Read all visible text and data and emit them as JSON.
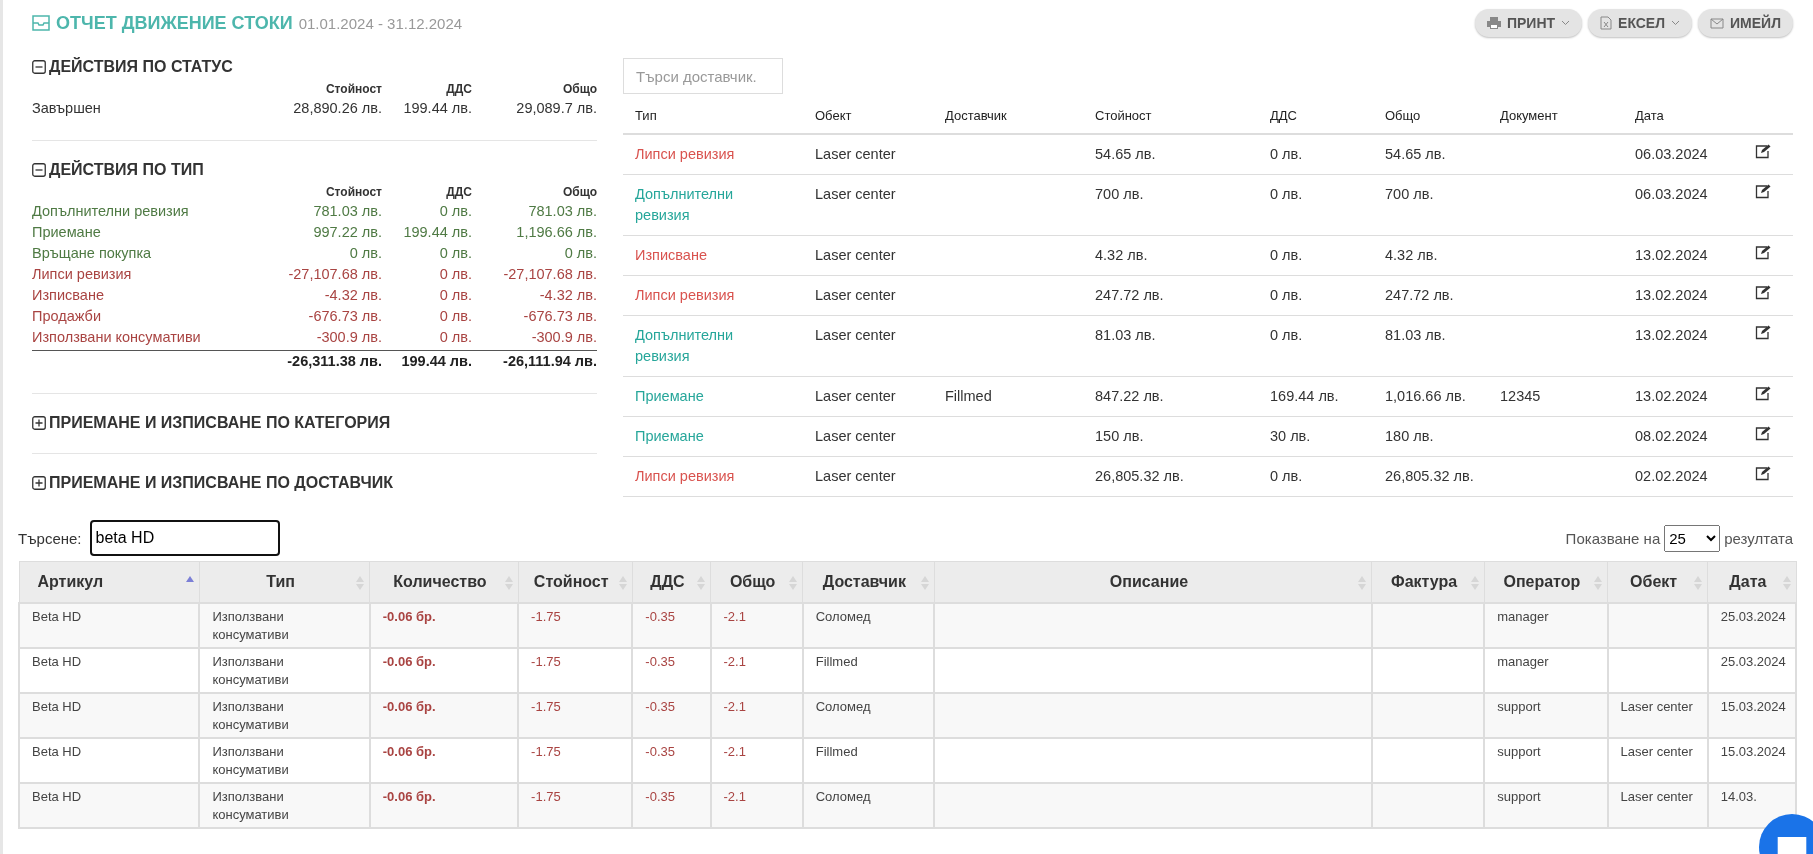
{
  "header": {
    "title": "ОТЧЕТ ДВИЖЕНИЕ СТОКИ",
    "period": "01.01.2024 - 31.12.2024"
  },
  "actions": [
    {
      "label": "ПРИНТ",
      "kind": "print",
      "dropdown": true
    },
    {
      "label": "ЕКСЕЛ",
      "kind": "excel",
      "dropdown": true
    },
    {
      "label": "ИМЕЙЛ",
      "kind": "email",
      "dropdown": false
    }
  ],
  "sections": [
    {
      "title": "ДЕЙСТВИЯ ПО СТАТУС",
      "expanded": true,
      "columns": [
        "Стойност",
        "ДДС",
        "Общо"
      ],
      "rows": [
        {
          "label": "Завършен",
          "kind": "neutral",
          "cells": [
            "28,890.26 лв.",
            "199.44 лв.",
            "29,089.7 лв."
          ]
        }
      ]
    },
    {
      "title": "ДЕЙСТВИЯ ПО ТИП",
      "expanded": true,
      "columns": [
        "Стойност",
        "ДДС",
        "Общо"
      ],
      "rows": [
        {
          "label": "Допълнителни ревизия",
          "kind": "positive",
          "cells": [
            "781.03 лв.",
            "0 лв.",
            "781.03 лв."
          ]
        },
        {
          "label": "Приемане",
          "kind": "positive",
          "cells": [
            "997.22 лв.",
            "199.44 лв.",
            "1,196.66 лв."
          ]
        },
        {
          "label": "Връщане покупка",
          "kind": "positive",
          "cells": [
            "0 лв.",
            "0 лв.",
            "0 лв."
          ]
        },
        {
          "label": "Липси ревизия",
          "kind": "negative",
          "cells": [
            "-27,107.68 лв.",
            "0 лв.",
            "-27,107.68 лв."
          ]
        },
        {
          "label": "Изписване",
          "kind": "negative",
          "cells": [
            "-4.32 лв.",
            "0 лв.",
            "-4.32 лв."
          ]
        },
        {
          "label": "Продажби",
          "kind": "negative",
          "cells": [
            "-676.73 лв.",
            "0 лв.",
            "-676.73 лв."
          ]
        },
        {
          "label": "Използвани консумативи",
          "kind": "negative",
          "cells": [
            "-300.9 лв.",
            "0 лв.",
            "-300.9 лв."
          ]
        }
      ],
      "totals": [
        "-26,311.38 лв.",
        "199.44 лв.",
        "-26,111.94 лв."
      ]
    },
    {
      "title": "ПРИЕМАНЕ И ИЗПИСВАНЕ ПО КАТЕГОРИЯ",
      "expanded": false
    },
    {
      "title": "ПРИЕМАНЕ И ИЗПИСВАНЕ ПО ДОСТАВЧИК",
      "expanded": false
    }
  ],
  "supplier_search": {
    "placeholder": "Търси доставчик."
  },
  "documents": {
    "columns": [
      "Тип",
      "Обект",
      "Доставчик",
      "Стойност",
      "ДДС",
      "Общо",
      "Документ",
      "Дата"
    ],
    "rows": [
      {
        "kind": "negative",
        "cells": [
          "Липси ревизия",
          "Laser center",
          "",
          "54.65 лв.",
          "0 лв.",
          "54.65 лв.",
          "",
          "06.03.2024"
        ]
      },
      {
        "kind": "positive",
        "cells": [
          "Допълнителни ревизия",
          "Laser center",
          "",
          "700 лв.",
          "0 лв.",
          "700 лв.",
          "",
          "06.03.2024"
        ]
      },
      {
        "kind": "negative",
        "cells": [
          "Изписване",
          "Laser center",
          "",
          "4.32 лв.",
          "0 лв.",
          "4.32 лв.",
          "",
          "13.02.2024"
        ]
      },
      {
        "kind": "negative",
        "cells": [
          "Липси ревизия",
          "Laser center",
          "",
          "247.72 лв.",
          "0 лв.",
          "247.72 лв.",
          "",
          "13.02.2024"
        ]
      },
      {
        "kind": "positive",
        "cells": [
          "Допълнителни ревизия",
          "Laser center",
          "",
          "81.03 лв.",
          "0 лв.",
          "81.03 лв.",
          "",
          "13.02.2024"
        ]
      },
      {
        "kind": "positive",
        "cells": [
          "Приемане",
          "Laser center",
          "Fillmed",
          "847.22 лв.",
          "169.44 лв.",
          "1,016.66 лв.",
          "12345",
          "13.02.2024"
        ]
      },
      {
        "kind": "positive",
        "cells": [
          "Приемане",
          "Laser center",
          "",
          "150 лв.",
          "30 лв.",
          "180 лв.",
          "",
          "08.02.2024"
        ]
      },
      {
        "kind": "negative",
        "cells": [
          "Липси ревизия",
          "Laser center",
          "",
          "26,805.32 лв.",
          "0 лв.",
          "26,805.32 лв.",
          "",
          "02.02.2024"
        ]
      }
    ]
  },
  "search": {
    "label": "Търсене:",
    "value": "beta HD"
  },
  "page_size": {
    "prefix": "Показване на",
    "value": "25",
    "suffix": "резултата"
  },
  "items": {
    "columns": [
      {
        "label": "Артикул",
        "sorted_ascending": true
      },
      {
        "label": "Тип",
        "sorted_ascending": false
      },
      {
        "label": "Количество",
        "sorted_ascending": false
      },
      {
        "label": "Стойност",
        "sorted_ascending": false
      },
      {
        "label": "ДДС",
        "sorted_ascending": false
      },
      {
        "label": "Общо",
        "sorted_ascending": false
      },
      {
        "label": "Доставчик",
        "sorted_ascending": false
      },
      {
        "label": "Описание",
        "sorted_ascending": false
      },
      {
        "label": "Фактура",
        "sorted_ascending": false
      },
      {
        "label": "Оператор",
        "sorted_ascending": false
      },
      {
        "label": "Обект",
        "sorted_ascending": false
      },
      {
        "label": "Дата",
        "sorted_ascending": false
      }
    ],
    "rows": [
      [
        "Beta HD",
        "Използвани консумативи",
        "-0.06 бр.",
        "-1.75",
        "-0.35",
        "-2.1",
        "Соломед",
        "",
        "",
        "manager",
        "",
        "25.03.2024"
      ],
      [
        "Beta HD",
        "Използвани консумативи",
        "-0.06 бр.",
        "-1.75",
        "-0.35",
        "-2.1",
        "Fillmed",
        "",
        "",
        "manager",
        "",
        "25.03.2024"
      ],
      [
        "Beta HD",
        "Използвани консумативи",
        "-0.06 бр.",
        "-1.75",
        "-0.35",
        "-2.1",
        "Соломед",
        "",
        "",
        "support",
        "Laser center",
        "15.03.2024"
      ],
      [
        "Beta HD",
        "Използвани консумативи",
        "-0.06 бр.",
        "-1.75",
        "-0.35",
        "-2.1",
        "Fillmed",
        "",
        "",
        "support",
        "Laser center",
        "15.03.2024"
      ],
      [
        "Beta HD",
        "Използвани консумативи",
        "-0.06 бр.",
        "-1.75",
        "-0.35",
        "-2.1",
        "Соломед",
        "",
        "",
        "support",
        "Laser center",
        "14.03."
      ]
    ]
  }
}
